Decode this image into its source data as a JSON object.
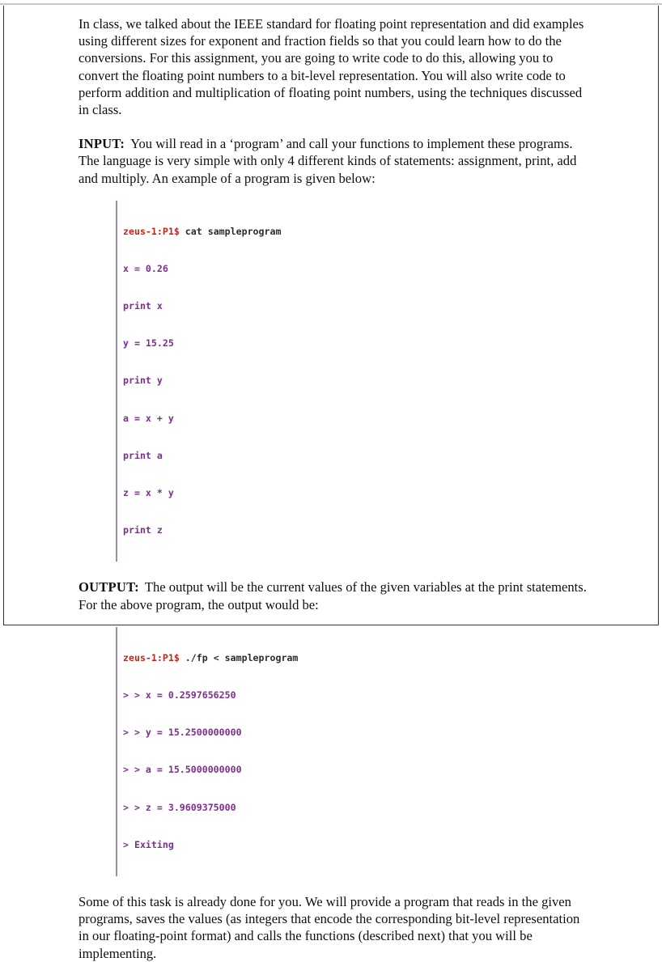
{
  "document": {
    "paragraphs": [
      {
        "id": "intro",
        "lead": "",
        "text": "In class, we talked about the IEEE standard for floating point representation and did examples using different sizes for exponent and fraction fields so that you could learn how to do the conversions.   For this assignment, you are going to write code to do this, allowing you to convert the floating point numbers to a bit-level representation.  You will also write code to perform addition and multiplication of floating point numbers, using the techniques discussed in class."
      },
      {
        "id": "input",
        "lead": "INPUT:",
        "text": "You will read in a ‘program’ and call your functions to implement these programs.   The language is very simple with only 4 different kinds of statements: assignment, print, add and multiply. An example of a program is given below:"
      },
      {
        "id": "output",
        "lead": "OUTPUT:",
        "text": "The output will be the current values of the given variables at the print statements.  For the above program, the output would be:"
      },
      {
        "id": "closing",
        "lead": "",
        "text": "Some of this task is already done for you.  We will provide a program that reads in the given programs, saves the values (as integers that encode the corresponding bit-level representation in our floating-point format)  and calls the functions (described next) that you will be implementing."
      }
    ],
    "code_blocks": {
      "sample_program": {
        "prompt": "zeus-1:P1$",
        "command": "cat sampleprogram",
        "lines": [
          "x = 0.26",
          "print x",
          "y = 15.25",
          "print y",
          "a = x + y",
          "print a",
          "z = x * y",
          "print z"
        ]
      },
      "program_output": {
        "prompt": "zeus-1:P1$",
        "command": "./fp < sampleprogram",
        "lines": [
          "> > x = 0.2597656250",
          "> > y = 15.2500000000",
          "> > a = 15.5000000000",
          "> > z = 3.9609375000",
          "> Exiting"
        ]
      }
    },
    "colors": {
      "prompt": "#c0251c",
      "command": "#2b2b2b",
      "code_text": "#7d2f8f",
      "code_rule": "#9a8ba8",
      "body_text": "#101010",
      "page_border": "#333333",
      "top_rule": "#c8c8c8"
    }
  }
}
